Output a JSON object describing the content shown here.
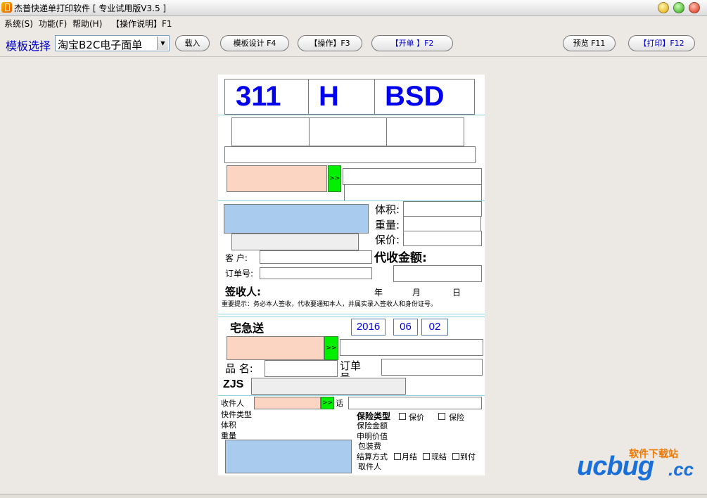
{
  "window": {
    "title": "杰普快递单打印软件 [ 专业试用版V3.5 ]"
  },
  "menu": [
    "系统(S)",
    "功能(F)",
    "帮助(H)",
    "【操作说明】F1"
  ],
  "toolbar": {
    "template_label": "模板选择",
    "template_value": "淘宝B2C电子面单",
    "load": "载入",
    "design": "模板设计 F4",
    "operate": "【操作】F3",
    "open_order": "【开单 】F2",
    "preview": "预览 F11",
    "print": "【打印】F12"
  },
  "paper": {
    "codes": [
      "311",
      "H",
      "BSD"
    ],
    "arrow": ">>",
    "volume": "体积:",
    "weight": "重量:",
    "insured": "保价:",
    "customer": "客  户:",
    "order_no": "订单号:",
    "cod_amount": "代收金额:",
    "signer": "签收人:",
    "year": "年",
    "month": "月",
    "day": "日",
    "notice": "重要提示：务必本人签收，代收要通知本人，并属实录入签收人和身份证号。",
    "home_delivery": "宅急送",
    "date": {
      "year": "2016",
      "month": "06",
      "day": "02"
    },
    "product_name": "品  名:",
    "order_label": "订单号",
    "zjs": "ZJS",
    "recipient": "收件人",
    "phone_suffix": "话",
    "express_type": "快件类型",
    "volume2": "体积",
    "weight2": "重量",
    "insurance_type": "保险类型",
    "opt_insured": "保价",
    "opt_insurance": "保险",
    "insured_amount": "保险金额",
    "declared_value": "申明价值",
    "packing_fee": "包装费",
    "settle_method": "结算方式",
    "opt_monthly": "月结",
    "opt_cash": "现结",
    "opt_cod": "到付",
    "pickup_person": "取件人"
  },
  "watermark": {
    "cn": "软件下载站",
    "en": "ucbug",
    "tld": ".cc"
  }
}
